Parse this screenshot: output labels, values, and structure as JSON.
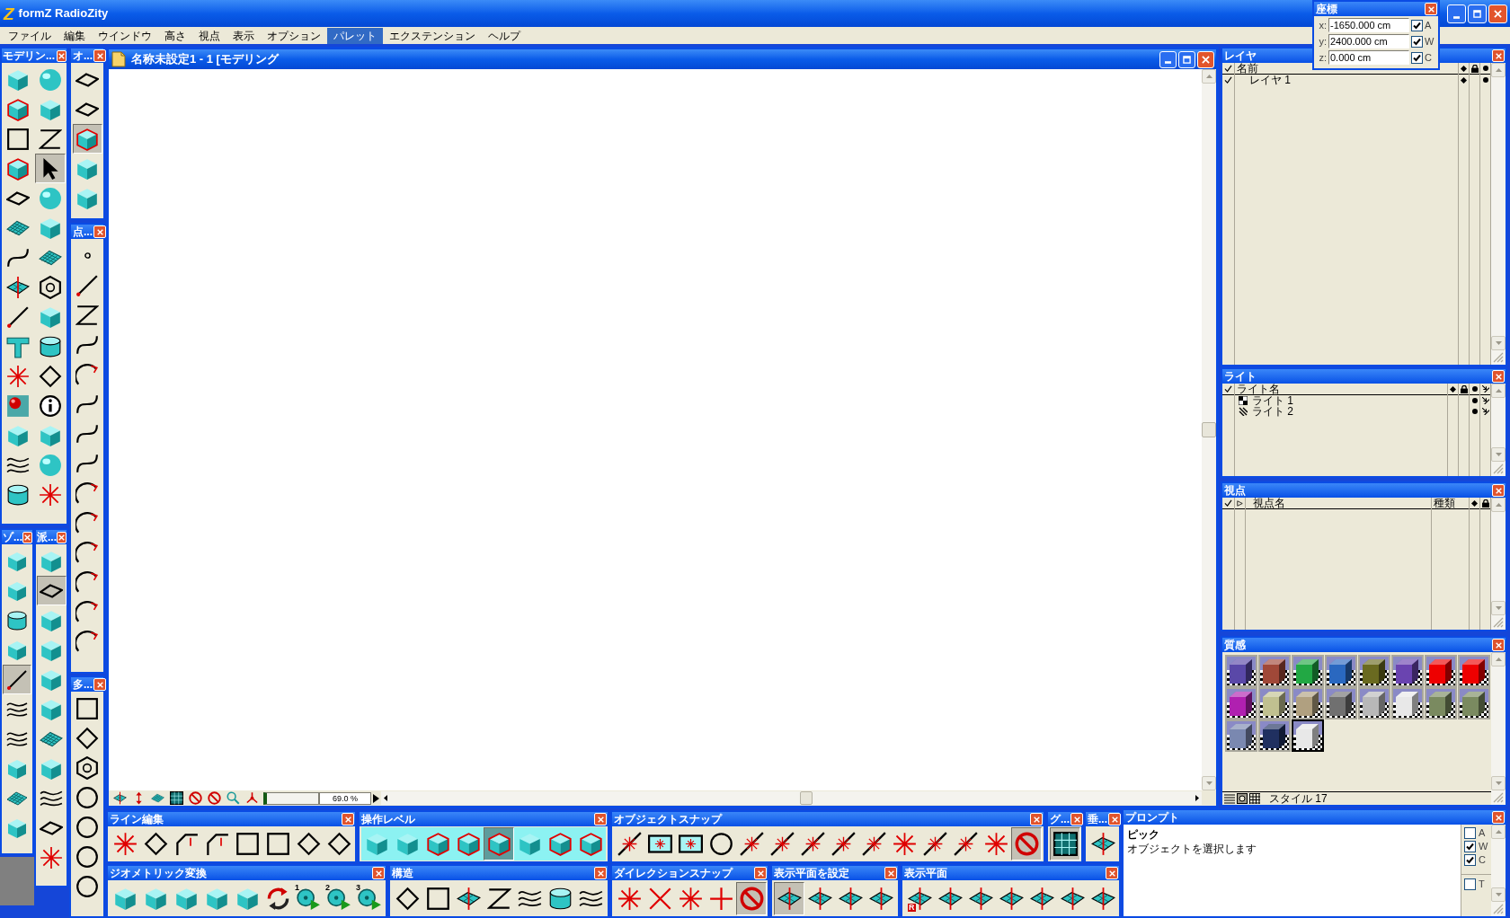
{
  "app": {
    "logo": "Z",
    "title": "formZ RadioZity"
  },
  "menu": [
    {
      "label": "ファイル",
      "selected": false
    },
    {
      "label": "編集",
      "selected": false
    },
    {
      "label": "ウインドウ",
      "selected": false
    },
    {
      "label": "高さ",
      "selected": false
    },
    {
      "label": "視点",
      "selected": false
    },
    {
      "label": "表示",
      "selected": false
    },
    {
      "label": "オプション",
      "selected": false
    },
    {
      "label": "パレット",
      "selected": true
    },
    {
      "label": "エクステンション",
      "selected": false
    },
    {
      "label": "ヘルプ",
      "selected": false
    }
  ],
  "coordinates": {
    "title": "座標",
    "rows": [
      {
        "axis": "x:",
        "value": "-1650.000 cm",
        "checked": true,
        "flag": "A"
      },
      {
        "axis": "y:",
        "value": "2400.000 cm",
        "checked": true,
        "flag": "W"
      },
      {
        "axis": "z:",
        "value": "0.000 cm",
        "checked": true,
        "flag": "C"
      }
    ]
  },
  "palettes": [
    {
      "title": "モデリン...",
      "tools": [
        {
          "selected": false
        },
        {
          "selected": false
        },
        {
          "selected": false
        },
        {
          "selected": false
        },
        {
          "selected": false
        },
        {
          "selected": false
        },
        {
          "selected": false
        },
        {
          "selected": true
        },
        {
          "selected": false
        },
        {
          "selected": false
        },
        {
          "selected": false
        },
        {
          "selected": false
        },
        {
          "selected": false
        },
        {
          "selected": false
        },
        {
          "selected": false
        },
        {
          "selected": false
        },
        {
          "selected": false
        },
        {
          "selected": false
        },
        {
          "selected": false
        },
        {
          "selected": false
        },
        {
          "selected": false
        },
        {
          "selected": false
        },
        {
          "selected": false
        },
        {
          "selected": false
        },
        {
          "selected": false
        },
        {
          "selected": false
        },
        {
          "selected": false
        },
        {
          "selected": false
        },
        {
          "selected": false
        },
        {
          "selected": false
        }
      ]
    },
    {
      "title": "オ...",
      "tools": [
        {
          "selected": false
        },
        {
          "selected": false
        },
        {
          "selected": true
        },
        {
          "selected": false
        },
        {
          "selected": false
        }
      ]
    },
    {
      "title": "点...",
      "tools": [
        {
          "selected": false
        },
        {
          "selected": false
        },
        {
          "selected": false
        },
        {
          "selected": false
        },
        {
          "selected": false
        },
        {
          "selected": false
        },
        {
          "selected": false
        },
        {
          "selected": false
        },
        {
          "selected": false
        },
        {
          "selected": false
        },
        {
          "selected": false
        },
        {
          "selected": false
        },
        {
          "selected": false
        },
        {
          "selected": false
        }
      ]
    },
    {
      "title": "多...",
      "tools": [
        {
          "selected": false
        },
        {
          "selected": false
        },
        {
          "selected": false
        },
        {
          "selected": false
        },
        {
          "selected": false
        },
        {
          "selected": false
        },
        {
          "selected": false
        }
      ]
    },
    {
      "title": "ゾ...",
      "tools": [
        {
          "selected": false
        },
        {
          "selected": false
        },
        {
          "selected": false
        },
        {
          "selected": false
        },
        {
          "selected": true
        },
        {
          "selected": false
        },
        {
          "selected": false
        },
        {
          "selected": false
        },
        {
          "selected": false
        },
        {
          "selected": false
        }
      ]
    },
    {
      "title": "派...",
      "tools": [
        {
          "selected": false
        },
        {
          "selected": true
        },
        {
          "selected": false
        },
        {
          "selected": false
        },
        {
          "selected": false
        },
        {
          "selected": false
        },
        {
          "selected": false
        },
        {
          "selected": false
        },
        {
          "selected": false
        },
        {
          "selected": false
        },
        {
          "selected": false
        }
      ]
    },
    {
      "title": "ライン編集",
      "tools": [
        {
          "selected": false
        },
        {
          "selected": false
        },
        {
          "selected": false
        },
        {
          "selected": false
        },
        {
          "selected": false
        },
        {
          "selected": false
        },
        {
          "selected": false
        },
        {
          "selected": false
        }
      ]
    },
    {
      "title": "操作レベル",
      "tools": [
        {
          "selected": false
        },
        {
          "selected": false
        },
        {
          "selected": false
        },
        {
          "selected": false
        },
        {
          "selected": true
        },
        {
          "selected": false
        },
        {
          "selected": false
        },
        {
          "selected": false
        }
      ]
    },
    {
      "title": "オブジェクトスナップ",
      "tools": [
        {
          "selected": false
        },
        {
          "selected": false
        },
        {
          "selected": false
        },
        {
          "selected": false
        },
        {
          "selected": false
        },
        {
          "selected": false
        },
        {
          "selected": false
        },
        {
          "selected": false
        },
        {
          "selected": false
        },
        {
          "selected": false
        },
        {
          "selected": false
        },
        {
          "selected": false
        },
        {
          "selected": false
        },
        {
          "selected": true
        }
      ]
    },
    {
      "title": "グ...",
      "tools": [
        {
          "selected": true
        }
      ]
    },
    {
      "title": "垂...",
      "tools": [
        {
          "selected": false
        }
      ]
    },
    {
      "title": "ジオメトリック変換",
      "tools": [
        {
          "selected": false
        },
        {
          "selected": false
        },
        {
          "selected": false
        },
        {
          "selected": false
        },
        {
          "selected": false
        },
        {
          "selected": false
        },
        {
          "selected": false,
          "label": "1"
        },
        {
          "selected": false,
          "label": "2"
        },
        {
          "selected": false,
          "label": "3"
        }
      ]
    },
    {
      "title": "構造",
      "tools": [
        {
          "selected": false
        },
        {
          "selected": false
        },
        {
          "selected": false
        },
        {
          "selected": false
        },
        {
          "selected": false
        },
        {
          "selected": false
        },
        {
          "selected": false
        }
      ]
    },
    {
      "title": "ダイレクションスナップ",
      "tools": [
        {
          "selected": false
        },
        {
          "selected": false
        },
        {
          "selected": false
        },
        {
          "selected": false
        },
        {
          "selected": true
        }
      ]
    },
    {
      "title": "表示平面を設定",
      "tools": [
        {
          "selected": true
        },
        {
          "selected": false
        },
        {
          "selected": false
        },
        {
          "selected": false
        }
      ]
    },
    {
      "title": "表示平面",
      "tools": [
        {
          "selected": false,
          "label": "R"
        },
        {
          "selected": false
        },
        {
          "selected": false
        },
        {
          "selected": false
        },
        {
          "selected": false
        },
        {
          "selected": false
        },
        {
          "selected": false
        }
      ]
    }
  ],
  "document": {
    "title": "名称未設定1 - 1 [モデリング",
    "zoom": "69.0 %"
  },
  "layers": {
    "title": "レイヤ",
    "name_header": "名前",
    "rows": [
      {
        "name": "レイヤ 1",
        "checked": true,
        "active": true,
        "visible": true
      }
    ]
  },
  "lights": {
    "title": "ライト",
    "name_header": "ライト名",
    "rows": [
      {
        "name": "ライト 1",
        "kind": "spot",
        "visible": true,
        "shadow": true
      },
      {
        "name": "ライト 2",
        "kind": "distant",
        "visible": true,
        "shadow": true
      }
    ]
  },
  "views": {
    "title": "視点",
    "name_header": "視点名",
    "type_header": "種類"
  },
  "materials": {
    "title": "質感",
    "swatches": [
      {
        "color": "#5a48a8",
        "selected": false
      },
      {
        "color": "#a04838",
        "selected": false
      },
      {
        "color": "#22a844",
        "selected": false
      },
      {
        "color": "#2a68c0",
        "selected": false
      },
      {
        "color": "#6a6a20",
        "selected": false
      },
      {
        "color": "#6a44b0",
        "selected": false
      },
      {
        "color": "#ee0000",
        "selected": false
      },
      {
        "color": "#ee0000",
        "selected": false
      },
      {
        "color": "#b020b0",
        "selected": false
      },
      {
        "color": "#c0c090",
        "selected": false
      },
      {
        "color": "#b0a080",
        "selected": false
      },
      {
        "color": "#707070",
        "selected": false
      },
      {
        "color": "#b8b8b8",
        "selected": false
      },
      {
        "color": "#e8e8e8",
        "selected": false
      },
      {
        "color": "#7a8a60",
        "selected": false
      },
      {
        "color": "#7a8a60",
        "selected": false
      },
      {
        "color": "#7a88b0",
        "selected": false
      },
      {
        "color": "#203060",
        "selected": false
      },
      {
        "color": "#e8e8e8",
        "selected": true
      }
    ],
    "style": "スタイル 17"
  },
  "prompt": {
    "title": "プロンプト",
    "command": "ピック",
    "message": "オブジェクトを選択します",
    "options": [
      {
        "label": "A",
        "checked": false
      },
      {
        "label": "W",
        "checked": true
      },
      {
        "label": "C",
        "checked": true
      },
      {
        "label": "T",
        "checked": false
      }
    ]
  }
}
